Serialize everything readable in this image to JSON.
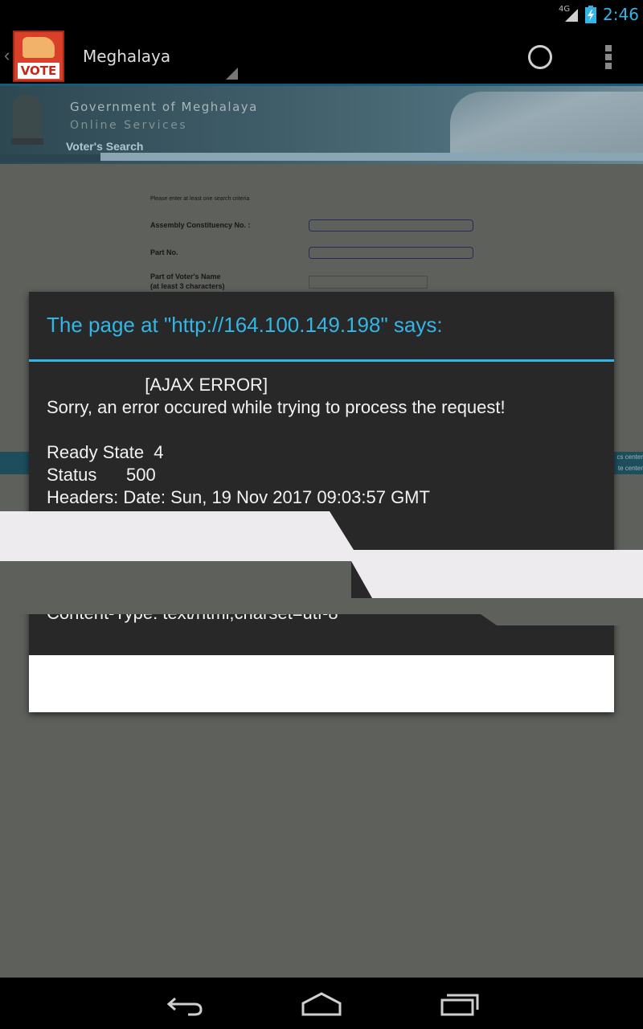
{
  "status_bar": {
    "network": "4G",
    "time": "2:46",
    "accent_color": "#33b5e5"
  },
  "action_bar": {
    "logo_text": "VOTE",
    "title": "Meghalaya",
    "icons": [
      "up-caret-icon",
      "app-logo",
      "refresh-icon",
      "overflow-menu-icon"
    ]
  },
  "banner": {
    "line1": "Government of Meghalaya",
    "line2": "Online Services",
    "section": "Voter's Search"
  },
  "form": {
    "hint": "Please enter at least one search criteria",
    "fields": [
      {
        "label": "Assembly Constituency No. :",
        "value": ""
      },
      {
        "label": "Part No.",
        "value": ""
      },
      {
        "label": "Part of Voter's Name",
        "sub_label": "(at least 3 characters)",
        "value": ""
      }
    ]
  },
  "footer_band": {
    "text1": "cs center",
    "text2": "te center"
  },
  "dialog": {
    "title": "The page at \"http://164.100.149.198\" says:",
    "error_heading": "                    [AJAX ERROR]",
    "error_message": "Sorry, an error occured while trying to process the request!",
    "ready_state_line": "Ready State  4",
    "status_line": "Status      500",
    "headers_line": "Headers: Date: Sun, 19 Nov 2017 09:03:57 GMT",
    "content_type_line": "Content-Type: text/html;charset=utf-8",
    "ok_button": ""
  },
  "nav_bar": {
    "buttons": [
      "back-icon",
      "home-icon",
      "recent-apps-icon"
    ]
  }
}
